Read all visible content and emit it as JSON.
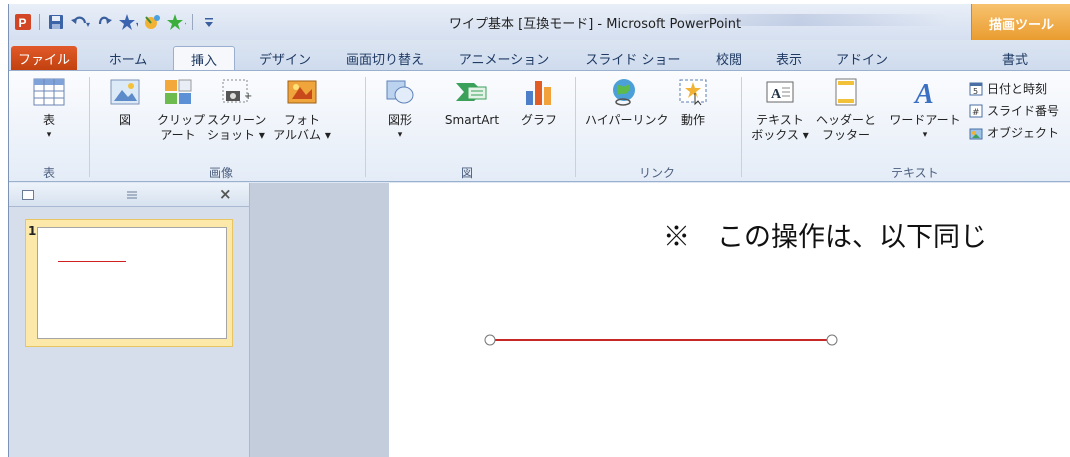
{
  "window": {
    "title": "ワイプ基本 [互換モード] - Microsoft PowerPoint",
    "context_tab_group": "描画ツール"
  },
  "tabs": [
    {
      "label": "ファイル"
    },
    {
      "label": "ホーム"
    },
    {
      "label": "挿入",
      "active": true
    },
    {
      "label": "デザイン"
    },
    {
      "label": "画面切り替え"
    },
    {
      "label": "アニメーション"
    },
    {
      "label": "スライド ショー"
    },
    {
      "label": "校閲"
    },
    {
      "label": "表示"
    },
    {
      "label": "アドイン"
    },
    {
      "label": "書式"
    }
  ],
  "ribbon": {
    "table": {
      "label": "表",
      "sub": "▾",
      "group": "表"
    },
    "images": {
      "picture": "図",
      "clipart": [
        "クリップ",
        "アート"
      ],
      "screenshot": [
        "スクリーン",
        "ショット ▾"
      ],
      "album": [
        "フォト",
        "アルバム ▾"
      ],
      "group": "画像"
    },
    "illustrations": {
      "shapes": "図形",
      "shapes_sub": "▾",
      "smartart": "SmartArt",
      "chart": "グラフ",
      "group": "図"
    },
    "links": {
      "hyperlink": "ハイパーリンク",
      "action": "動作",
      "group": "リンク"
    },
    "text": {
      "textbox": [
        "テキスト",
        "ボックス ▾"
      ],
      "header_footer": [
        "ヘッダーと",
        "フッター"
      ],
      "wordart": "ワードアート",
      "wordart_sub": "▾",
      "date_time": "日付と時刻",
      "slide_number": "スライド番号",
      "object": "オブジェクト",
      "group": "テキスト"
    }
  },
  "slides_pane": {
    "close": "×",
    "slide_number": "1"
  },
  "slide": {
    "caption": "※　この操作は、以下同じ",
    "line_color": "#c62828"
  }
}
